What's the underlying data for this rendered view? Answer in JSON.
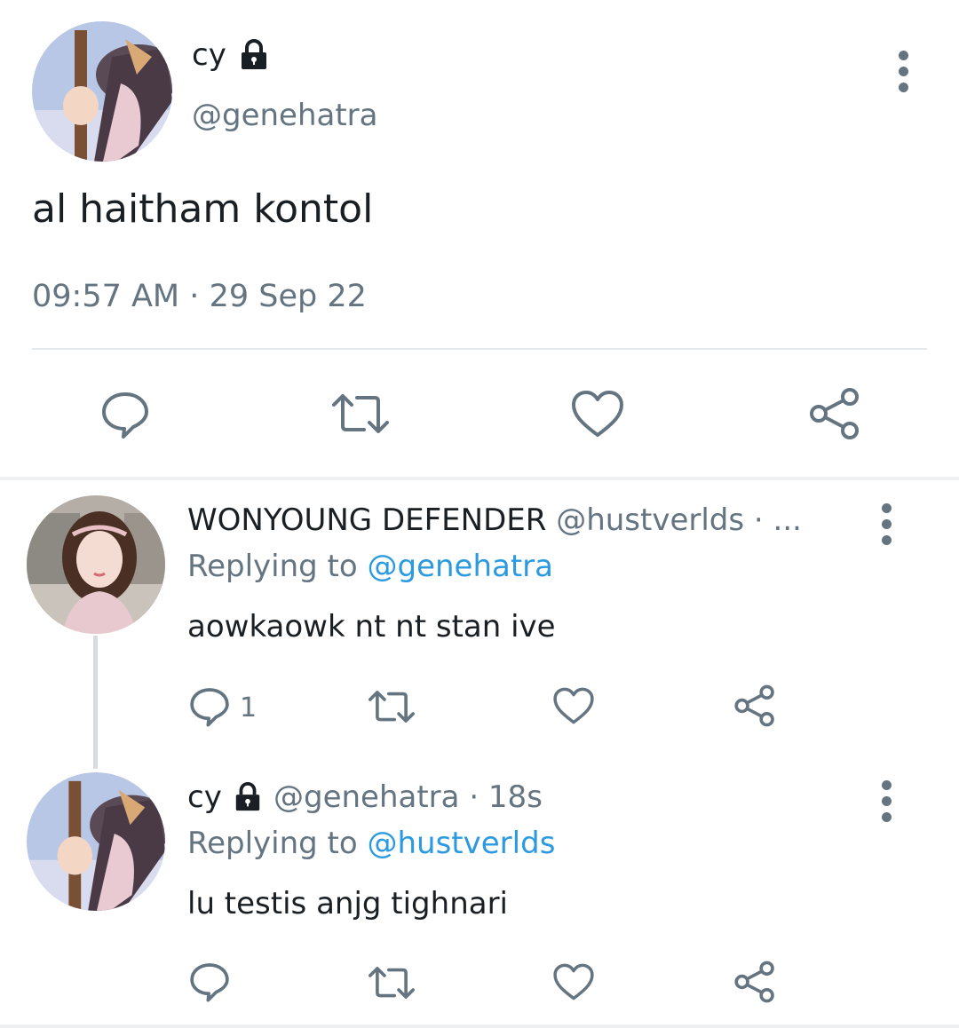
{
  "main_tweet": {
    "display_name": "cy",
    "handle": "@genehatra",
    "text": "al haitham kontol",
    "timestamp": "09:57 AM",
    "date": "29 Sep 22",
    "separator": "·"
  },
  "reply_1": {
    "display_name": "WONYOUNG DEFENDER",
    "handle": "@hustverlds",
    "meta_suffix": "· ...",
    "replying_prefix": "Replying to",
    "replying_handle": "@genehatra",
    "text": "aowkaowk nt nt stan ive",
    "reply_count": "1"
  },
  "reply_2": {
    "display_name": "cy",
    "handle": "@genehatra",
    "time": "· 18s",
    "replying_prefix": "Replying to",
    "replying_handle": "@hustverlds",
    "text": "lu testis anjg tighnari"
  },
  "colors": {
    "text": "#1a1f24",
    "muted": "#647480",
    "link": "#2b9ae0",
    "divider": "#e6e9eb"
  },
  "icons": [
    "lock-icon",
    "more-icon",
    "reply-icon",
    "retweet-icon",
    "like-icon",
    "share-icon"
  ]
}
